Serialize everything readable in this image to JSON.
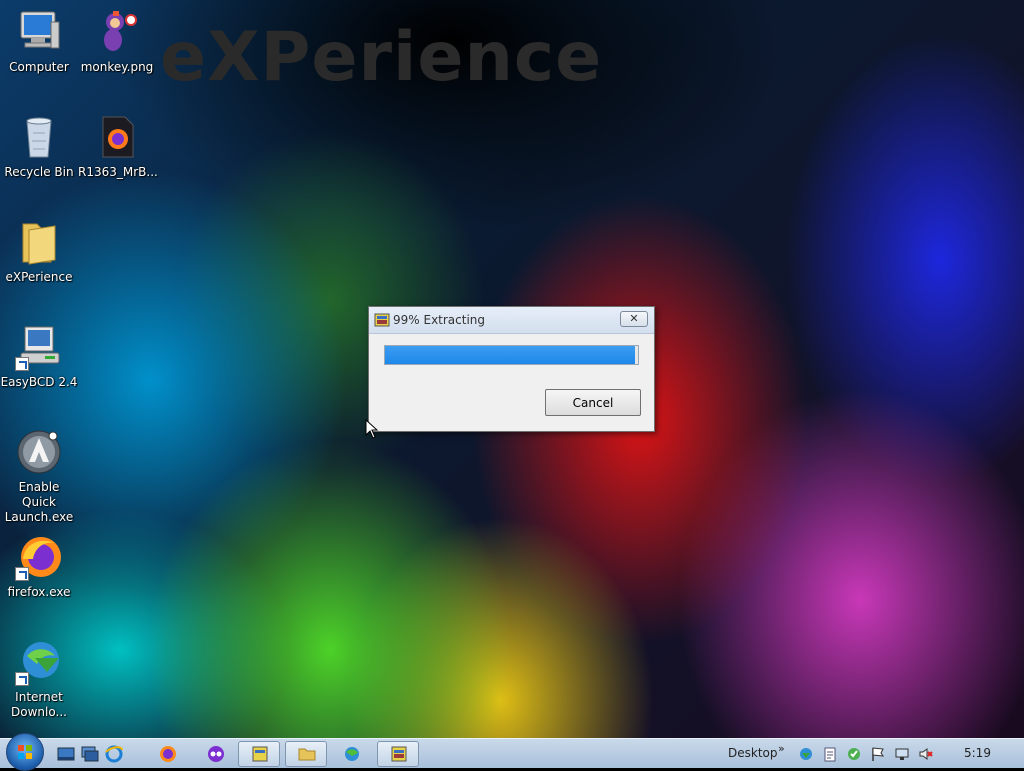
{
  "wallpaper": {
    "title": "eXPerience"
  },
  "desktop": {
    "icons": [
      {
        "label": "Computer"
      },
      {
        "label": "monkey.png"
      },
      {
        "label": "Recycle Bin"
      },
      {
        "label": "R1363_MrB..."
      },
      {
        "label": "eXPerience"
      },
      {
        "label": "EasyBCD 2.4"
      },
      {
        "label": "Enable Quick Launch.exe"
      },
      {
        "label": "firefox.exe"
      },
      {
        "label": "Internet Downlo..."
      }
    ]
  },
  "dialog": {
    "title": "99% Extracting",
    "close_label": "✕",
    "progress": 0.99,
    "cancel_label": "Cancel"
  },
  "taskbar": {
    "desktop_label": "Desktop",
    "chevron": "»",
    "clock": "5:19"
  },
  "colors": {
    "progress_fill": "#1d88ea",
    "taskbar": "#b9cde3"
  }
}
